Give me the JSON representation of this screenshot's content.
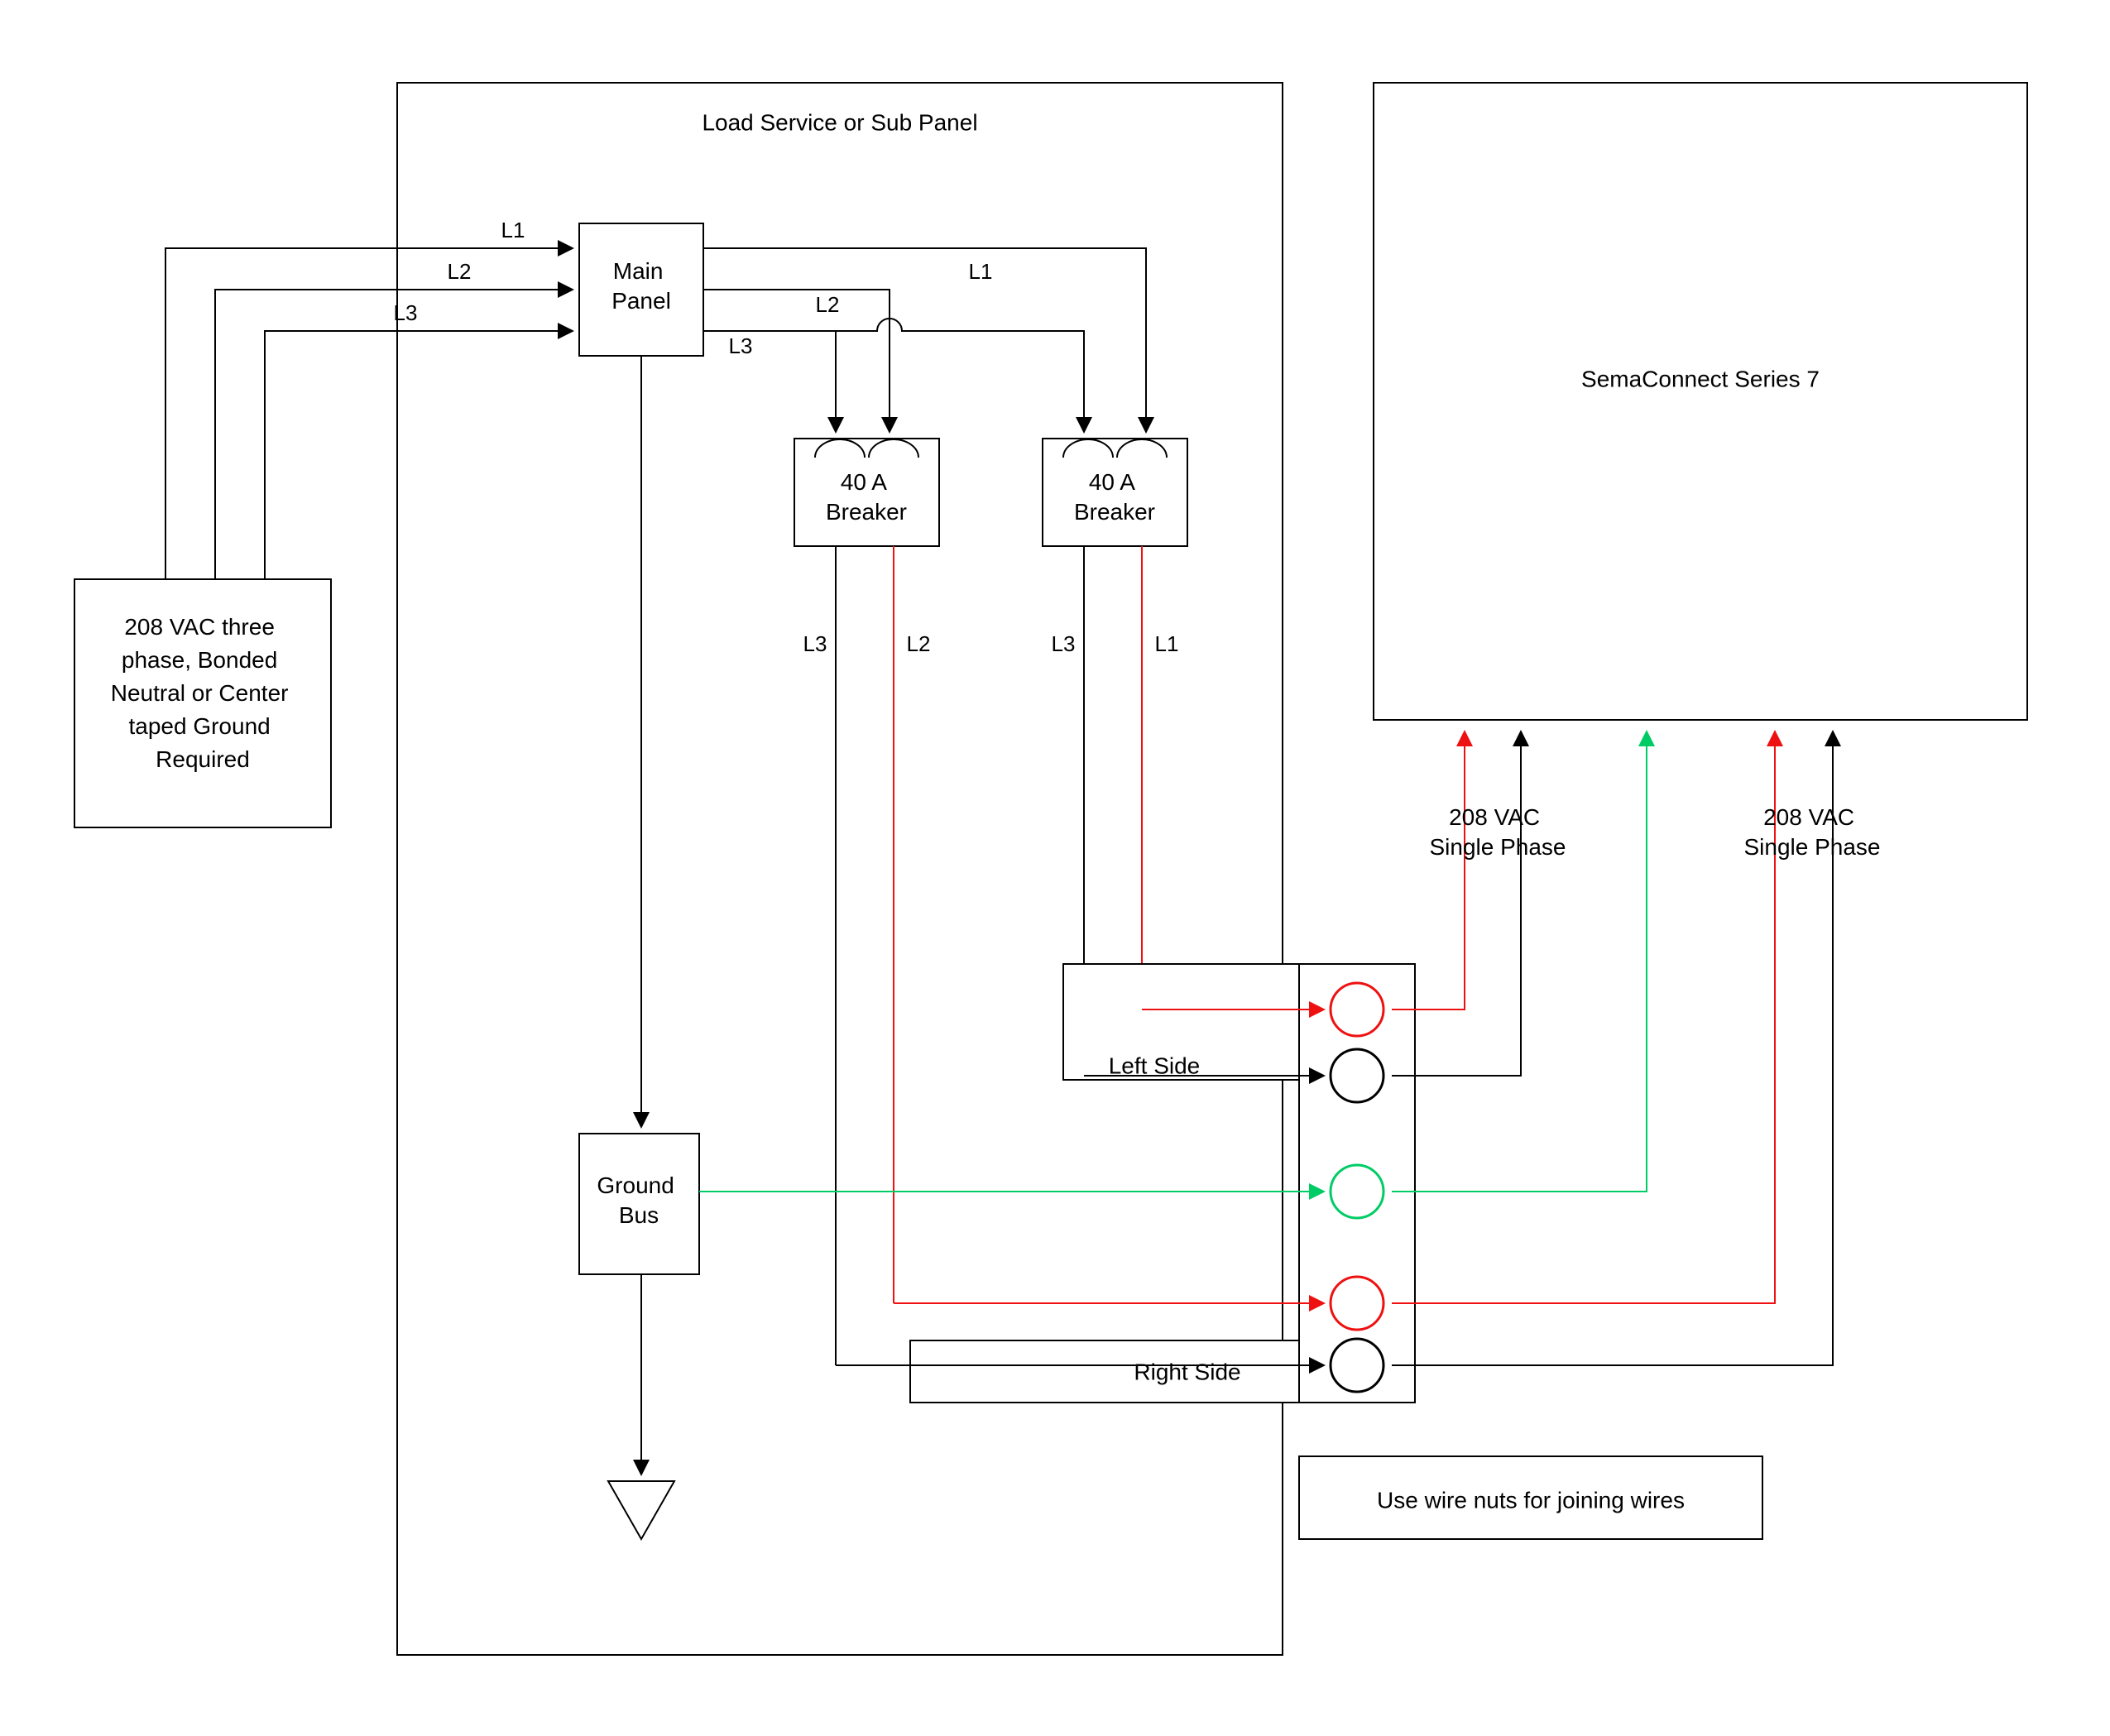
{
  "panel": {
    "title": "Load Service or Sub Panel",
    "main_panel": "Main\nPanel",
    "breaker1": "40 A\nBreaker",
    "breaker2": "40 A\nBreaker",
    "ground_bus": "Ground\nBus",
    "left_side": "Left Side",
    "right_side": "Right Side",
    "wire_nuts": "Use wire nuts for joining wires",
    "L1": "L1",
    "L2": "L2",
    "L3": "L3"
  },
  "source": "208 VAC three\nphase, Bonded\nNeutral or Center\ntaped Ground\nRequired",
  "device": {
    "title": "SemaConnect Series 7",
    "feed1": "208 VAC\nSingle Phase",
    "feed2": "208 VAC\nSingle Phase"
  },
  "colors": {
    "black": "#000000",
    "red": "#ee1111",
    "green": "#00cc66"
  }
}
